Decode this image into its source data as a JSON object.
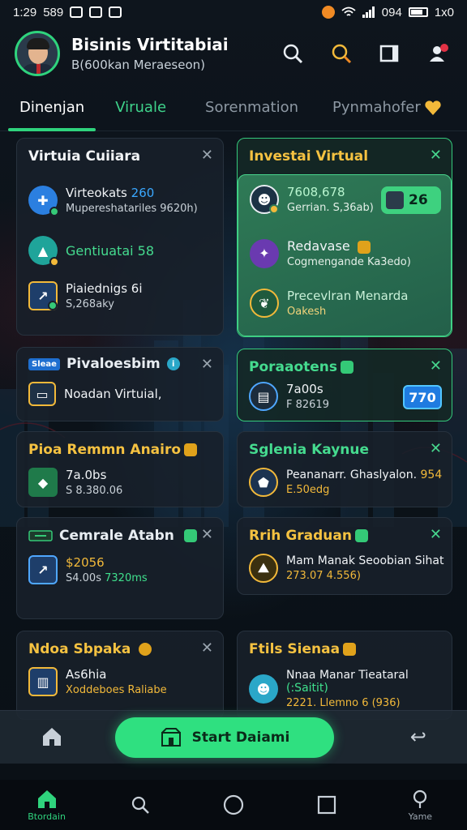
{
  "status": {
    "time": "1:29",
    "left_text": "589",
    "battery_text": "094",
    "right_text": "1x0"
  },
  "header": {
    "title": "Bisinis Virtitabiai",
    "subtitle": "B(600kan Meraeseon)"
  },
  "tabs": [
    {
      "label": "Dinenjan",
      "active": true
    },
    {
      "label": "Viruale",
      "active": false
    },
    {
      "label": "Sorenmation",
      "active": false
    },
    {
      "label": "Pynmahofer",
      "active": false
    }
  ],
  "cards": {
    "c1": {
      "title": "Virtuia Cuiiara",
      "rows": [
        {
          "l1": "Virteokats",
          "n1": "260",
          "l2": "Mupereshatariles 9620h)"
        },
        {
          "l1": "Gentiuatai",
          "n1": "58",
          "l2": ""
        },
        {
          "l1": "Piaiednigs",
          "n1": "6i",
          "l2": "S,268aky"
        }
      ]
    },
    "c2": {
      "title": "Investai Virtual",
      "pill": "26",
      "rows": [
        {
          "l1": "7608,678",
          "l2": "Gerrian. S,36ab)"
        },
        {
          "l1": "Redavase",
          "l2": "Cogmengande Ka3edo)"
        },
        {
          "l1": "Precevlran Menarda",
          "l2": "Oakesh"
        }
      ]
    },
    "c3": {
      "badge": "Sleae",
      "title": "Pivaloesbim",
      "rows": [
        {
          "l1": "Noadan Virtuial,"
        }
      ]
    },
    "c4": {
      "title": "Poraaotens",
      "pill": "770",
      "rows": [
        {
          "l1": "7a00s",
          "l2": "F 82619"
        }
      ]
    },
    "c5": {
      "title": "Pioa Remmn Anairo",
      "rows": [
        {
          "l1": "7a.0bs",
          "l2": "S 8.380.06"
        }
      ]
    },
    "c6": {
      "title": "Sglenia Kaynue",
      "rows": [
        {
          "l1": "Peananarr. Ghaslyalon.",
          "n1": "954",
          "l2": "E.50edg"
        }
      ]
    },
    "c7": {
      "title": "Cemrale Atabn",
      "rows": [
        {
          "l1": "$2056",
          "l2": "S4.00s",
          "n2": "7320ms"
        }
      ]
    },
    "c8": {
      "title": "Rrih Graduan",
      "rows": [
        {
          "l1": "Mam Manak Seoobian Sihat",
          "l2": "273.07 4.556)"
        }
      ]
    },
    "c9": {
      "title": "Ndoa Sbpaka",
      "rows": [
        {
          "l1": "As6hia",
          "l2": "Xoddeboes Raliabe"
        }
      ]
    },
    "c10": {
      "title": "Ftils Sienaa",
      "rows": [
        {
          "l1": "Nnaa Manar Tieataral",
          "n1": "(:Saitit)",
          "l2": "2221. Llemno 6 (936)"
        }
      ]
    }
  },
  "action_bar": {
    "start_label": "Start Daiami"
  },
  "nav": [
    {
      "label": "Btordain",
      "active": true
    },
    {
      "label": "",
      "active": false
    },
    {
      "label": "",
      "active": false
    },
    {
      "label": "",
      "active": false
    },
    {
      "label": "Yame",
      "active": false
    }
  ],
  "colors": {
    "accent_green": "#2fd37d",
    "blue": "#3aa8ff",
    "orange": "#f2b93a"
  }
}
